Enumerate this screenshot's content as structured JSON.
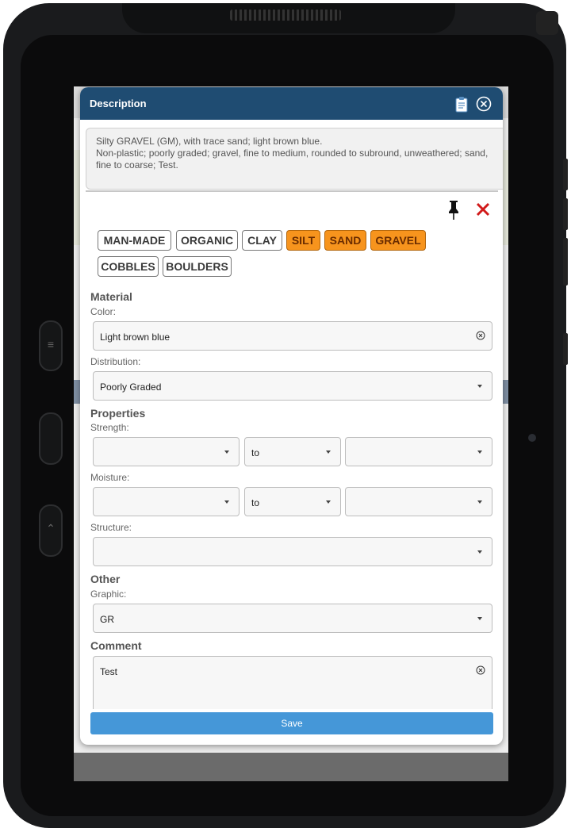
{
  "modal": {
    "title": "Description",
    "description_line1": "Silty GRAVEL (GM), with trace sand; light brown blue.",
    "description_line2": "Non-plastic; poorly graded; gravel, fine to medium, rounded to subround, unweathered; sand, fine to coarse; Test."
  },
  "icons": {
    "clipboard": "clipboard-icon",
    "close_header": "close-circle-icon",
    "pin": "pin-icon",
    "delete": "red-x-icon",
    "clear_field": "clear-circle-icon",
    "dropdown": "chevron-down-icon"
  },
  "soil_types": [
    {
      "label": "MAN-MADE",
      "selected": false
    },
    {
      "label": "ORGANIC",
      "selected": false
    },
    {
      "label": "CLAY",
      "selected": false
    },
    {
      "label": "SILT",
      "selected": true
    },
    {
      "label": "SAND",
      "selected": true
    },
    {
      "label": "GRAVEL",
      "selected": true
    },
    {
      "label": "COBBLES",
      "selected": false
    },
    {
      "label": "BOULDERS",
      "selected": false
    }
  ],
  "material": {
    "section_title": "Material",
    "color_label": "Color:",
    "color_value": "Light brown blue",
    "distribution_label": "Distribution:",
    "distribution_value": "Poorly Graded"
  },
  "properties": {
    "section_title": "Properties",
    "strength_label": "Strength:",
    "strength_from": "",
    "strength_to_label": "to",
    "strength_to": "",
    "moisture_label": "Moisture:",
    "moisture_from": "",
    "moisture_to_label": "to",
    "moisture_to": "",
    "structure_label": "Structure:",
    "structure_value": ""
  },
  "other": {
    "section_title": "Other",
    "graphic_label": "Graphic:",
    "graphic_value": "GR"
  },
  "comment": {
    "section_title": "Comment",
    "value": "Test"
  },
  "save_label": "Save",
  "colors": {
    "header": "#1f4c72",
    "selected_chip": "#f7941d",
    "save_button": "#4597d8",
    "delete_icon": "#d11a1a"
  }
}
